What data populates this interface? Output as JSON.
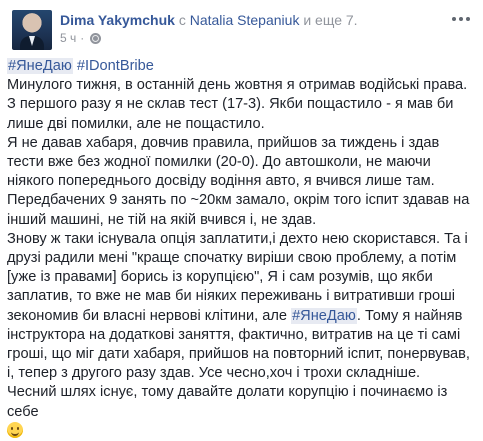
{
  "post": {
    "author": "Dima Yakymchuk",
    "with_word": "с",
    "tagged": "Natalia Stepaniuk",
    "and_more": "и еще 7.",
    "time": "5 ч",
    "privacy_icon": "globe-icon",
    "menu_icon": "ellipsis-icon"
  },
  "hashtags": [
    "#ЯнеДаю",
    "#IDontBribe"
  ],
  "paragraphs": [
    "Минулого тижня, в останній день жовтня я отримав водійські права. З першого разу я не склав тест (17-3). Якби пощастило - я мав би лише дві помилки, але не пощастило.",
    "Я не давав хабаря, довчив правила, прийшов за тиждень і здав тести вже без жодної помилки (20-0). До автошколи, не маючи ніякого попереднього досвіду водіння авто, я вчився лише там. Передбачених 9 занять по ~20км замало, окрім того іспит здавав на інший машині, не тій на якій вчився і, не здав.",
    {
      "before": "Знову ж таки існувала опція заплатити,і дехто нею скористався. Та і друзі радили мені \"краще спочатку виріши свою проблему, а потім [уже із правами] борись із корупцією\", Я і сам розумів, що якби заплатив, то вже не мав би ніяких переживань і витративши гроші зекономив би власні нервові клітини, але ",
      "tag": "#ЯнеДаю",
      "after": ". Тому я найняв інструктора на додаткові заняття, фактично, витратив на це ті самі гроші, що міг дати хабаря, прийшов на повторний іспит, понервував, і, тепер з другого разу здав. Усе чесно,хоч і трохи складніше."
    },
    "Чесний шлях існує, тому давайте долати корупцію і починаємо із себе"
  ],
  "emoji": "smile-emoji"
}
